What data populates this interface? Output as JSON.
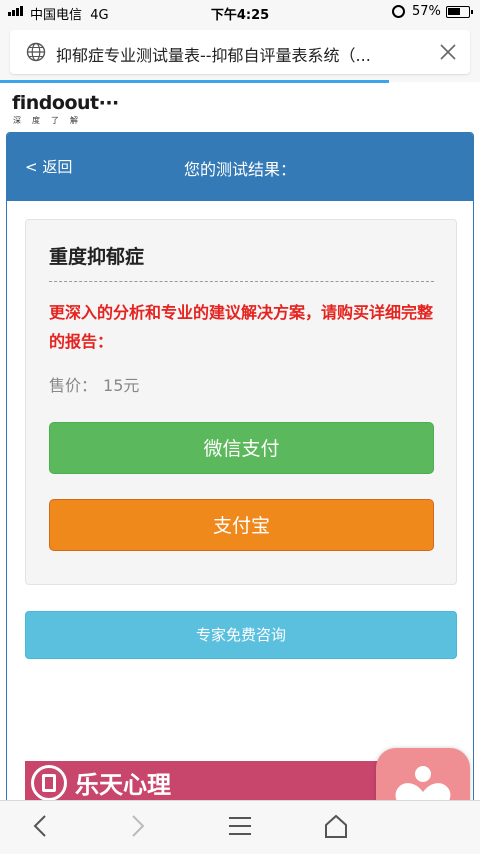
{
  "status_bar": {
    "carrier": "中国电信",
    "network": "4G",
    "time": "下午4:25",
    "battery": "57%"
  },
  "browser": {
    "page_title": "抑郁症专业测试量表--抑郁自评量表系统（...",
    "progress": 0.81
  },
  "logo": {
    "brand": "findoout···",
    "tagline": "深度了解"
  },
  "panel": {
    "back_label": "< 返回",
    "title": "您的测试结果："
  },
  "result": {
    "level": "重度抑郁症",
    "notice": "更深入的分析和专业的建议解决方案，请购买详细完整的报告：",
    "price_label": "售价：",
    "price_value": "15元"
  },
  "buttons": {
    "wechat_pay": "微信支付",
    "alipay": "支付宝",
    "consult": "专家免费咨询"
  },
  "banner": {
    "name": "乐天心理"
  },
  "colors": {
    "header_blue": "#337ab7",
    "notice_red": "#e5231f",
    "wechat_green": "#5cb85c",
    "alipay_orange": "#f0891c",
    "consult_cyan": "#5bc0de",
    "banner_pink": "#c8456c"
  },
  "icons": {
    "url_left": "globe-icon",
    "url_right": "close-icon",
    "nav": [
      "back-arrow-icon",
      "forward-arrow-icon",
      "menu-icon",
      "home-icon"
    ],
    "floating": "heart-person-app-icon"
  }
}
